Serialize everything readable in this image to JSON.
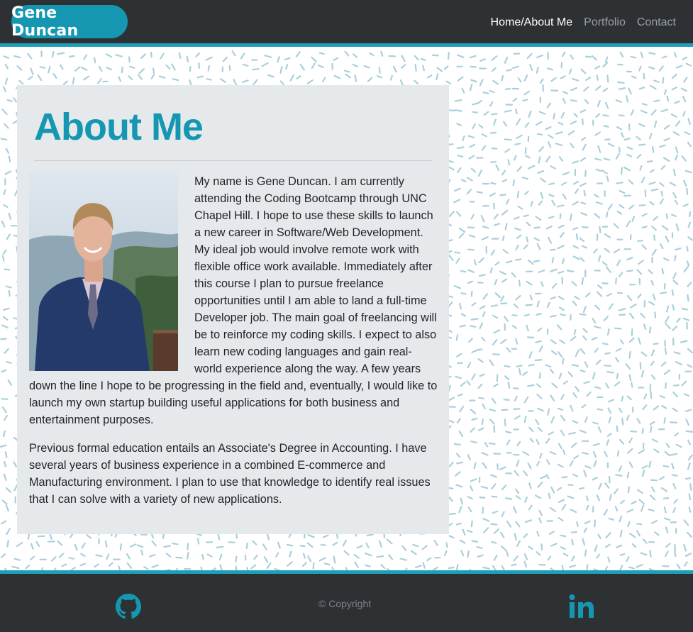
{
  "nav": {
    "brand": "Gene Duncan",
    "links": [
      {
        "label": "Home/About Me",
        "active": true
      },
      {
        "label": "Portfolio",
        "active": false
      },
      {
        "label": "Contact",
        "active": false
      }
    ]
  },
  "about": {
    "title": "About Me",
    "photo_alt": "Portrait of Gene Duncan",
    "para1_a": "My name is Gene Duncan. I am currently attending the Coding Bootcamp through UNC Chapel Hill. I hope to use these skills to launch a new career in Software/Web Development. My ideal job would involve remote work with flexible office work available. Immediately after this course I plan to pursue freelance opportunities until I am able to land a full-time Developer job. The main goal of freelancing will be to reinforce my coding skills. I expect to also learn new coding languages and gain real-world experience along the way. A few years",
    "para1_b": "down the line I hope to be progressing in the field and, eventually, I would like to launch my own startup building useful applications for both business and entertainment purposes.",
    "para2": "Previous formal education entails an Associate's Degree in Accounting. I have several years of business experience in a combined E-commerce and Manufacturing environment. I plan to use that knowledge to identify real issues that I can solve with a variety of new applications."
  },
  "footer": {
    "copyright": "© Copyright",
    "github_icon": "github-icon",
    "linkedin_icon": "linkedin-icon"
  },
  "colors": {
    "accent": "#1597b2",
    "nav_bg": "#2e3134",
    "card_bg": "#e6e9ec",
    "pattern": "#a9cfdc"
  }
}
